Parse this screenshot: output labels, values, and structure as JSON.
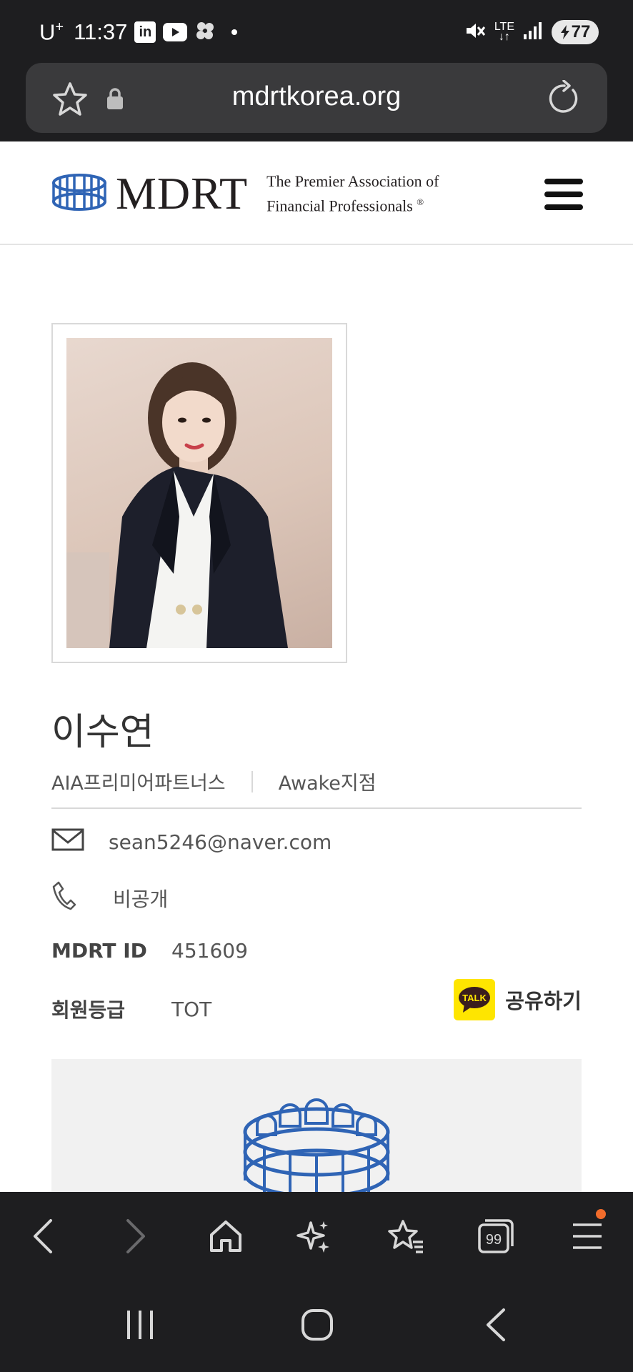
{
  "status_bar": {
    "carrier": "U",
    "carrier_sup": "+",
    "time": "11:37",
    "app_icons": [
      "linkedin-icon",
      "youtube-icon",
      "pinwheel-icon"
    ],
    "network": "LTE",
    "battery": "77"
  },
  "browser": {
    "url": "mdrtkorea.org",
    "toolbar_icons": [
      "back-icon",
      "forward-icon",
      "home-icon",
      "sparkle-icon",
      "bookmarks-icon",
      "tabs-icon",
      "menu-icon"
    ],
    "tab_count": "99"
  },
  "site": {
    "logo_text": "MDRT",
    "tagline_line1": "The Premier Association of",
    "tagline_line2": "Financial Professionals",
    "tagline_mark": "®"
  },
  "profile": {
    "name": "이수연",
    "company": "AIA프리미어파트너스",
    "branch": "Awake지점",
    "email": "sean5246@naver.com",
    "phone": "비공개",
    "mdrt_id_label": "MDRT ID",
    "mdrt_id": "451609",
    "grade_label": "회원등급",
    "grade": "TOT",
    "share_label": "공유하기",
    "kakao_badge": "TALK"
  },
  "colors": {
    "mdrt_blue": "#2f64b5",
    "kakao_yellow": "#fee500",
    "browser_dark": "#1e1e20",
    "notification_orange": "#f26c2b"
  }
}
